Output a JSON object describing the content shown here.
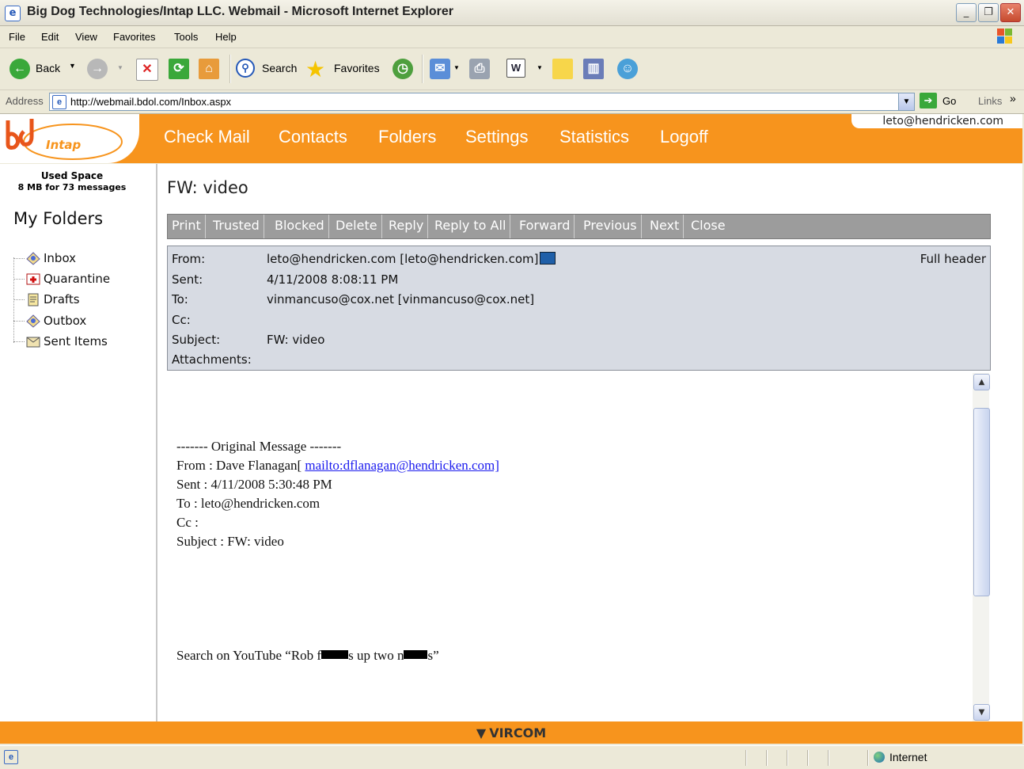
{
  "window": {
    "title": "Big Dog Technologies/Intap LLC. Webmail - Microsoft Internet Explorer",
    "controls": [
      "minimize",
      "maximize",
      "close"
    ]
  },
  "menubar": {
    "items": [
      "File",
      "Edit",
      "View",
      "Favorites",
      "Tools",
      "Help"
    ]
  },
  "toolbar": {
    "back_label": "Back",
    "search_label": "Search",
    "favorites_label": "Favorites"
  },
  "address": {
    "label": "Address",
    "url": "http://webmail.bdol.com/Inbox.aspx",
    "go_label": "Go",
    "links_label": "Links"
  },
  "webmail": {
    "logo_text": "Intap",
    "nav": [
      "Check Mail",
      "Contacts",
      "Folders",
      "Settings",
      "Statistics",
      "Logoff"
    ],
    "user_email": "leto@hendricken.com",
    "accent_color": "#f7941d"
  },
  "sidebar": {
    "used_space_label": "Used Space",
    "used_space_value": "8 MB for 73 messages",
    "my_folders_label": "My Folders",
    "folders": [
      {
        "label": "Inbox",
        "icon": "inbox-icon"
      },
      {
        "label": "Quarantine",
        "icon": "quarantine-icon"
      },
      {
        "label": "Drafts",
        "icon": "drafts-icon"
      },
      {
        "label": "Outbox",
        "icon": "outbox-icon"
      },
      {
        "label": "Sent Items",
        "icon": "sent-items-icon"
      }
    ]
  },
  "message": {
    "title": "FW: video",
    "actions": [
      "Print",
      "Trusted",
      "Blocked",
      "Delete",
      "Reply",
      "Reply to All",
      "Forward",
      "Previous",
      "Next",
      "Close"
    ],
    "full_header_label": "Full header",
    "headers": {
      "from_label": "From:",
      "from_value": "leto@hendricken.com [leto@hendricken.com]",
      "sent_label": "Sent:",
      "sent_value": "4/11/2008 8:08:11 PM",
      "to_label": "To:",
      "to_value": "vinmancuso@cox.net [vinmancuso@cox.net]",
      "cc_label": "Cc:",
      "cc_value": "",
      "subject_label": "Subject:",
      "subject_value": "FW: video",
      "attachments_label": "Attachments:",
      "attachments_value": ""
    },
    "body": {
      "original_line": "------- Original Message -------",
      "from_prefix": "From : Dave Flanagan[ ",
      "from_link": "mailto:dflanagan@hendricken.com]",
      "sent_line": "Sent : 4/11/2008 5:30:48 PM",
      "to_line": "To : leto@hendricken.com",
      "cc_line": "Cc :",
      "subject_line": "Subject : FW: video",
      "search_part1": "Search on YouTube “Rob f",
      "search_part2": "s up two n",
      "search_part3": "s”"
    }
  },
  "footer": {
    "brand": "VIRCOM"
  },
  "statusbar": {
    "zone": "Internet"
  }
}
